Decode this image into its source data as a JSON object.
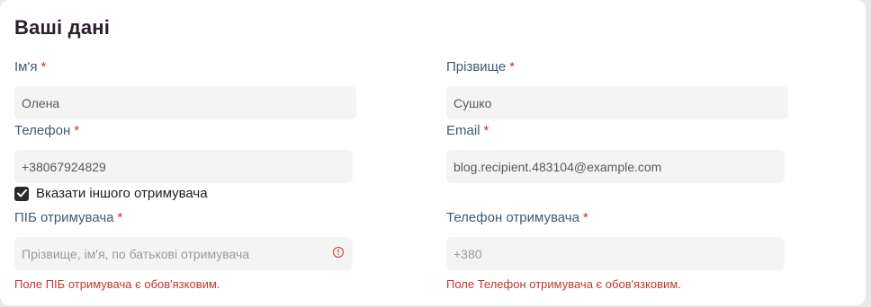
{
  "section": {
    "title": "Ваші дані"
  },
  "required_mark": "*",
  "fields": {
    "first_name": {
      "label": "Ім'я",
      "value": "Олена",
      "placeholder": ""
    },
    "last_name": {
      "label": "Прізвище",
      "value": "Сушко",
      "placeholder": ""
    },
    "phone": {
      "label": "Телефон",
      "value": "+38067924829",
      "placeholder": ""
    },
    "email": {
      "label": "Email",
      "value": "blog.recipient.483104@example.com",
      "placeholder": ""
    },
    "recipient_name": {
      "label": "ПІБ отримувача",
      "value": "",
      "placeholder": "Прізвище, ім'я, по батькові отримувача",
      "error": "Поле ПІБ отримувача є обов'язковим.",
      "error_icon": "alert-circle-icon"
    },
    "recipient_phone": {
      "label": "Телефон отримувача",
      "value": "",
      "placeholder": "+380",
      "error": "Поле Телефон отримувача є обов'язковим."
    }
  },
  "other_recipient": {
    "label": "Вказати іншого отримувача",
    "checked": true
  },
  "colors": {
    "label": "#3e5c74",
    "required": "#c0392b",
    "error": "#c0392b",
    "field_bg": "#f4f4f5",
    "title": "#2a1f2b"
  }
}
